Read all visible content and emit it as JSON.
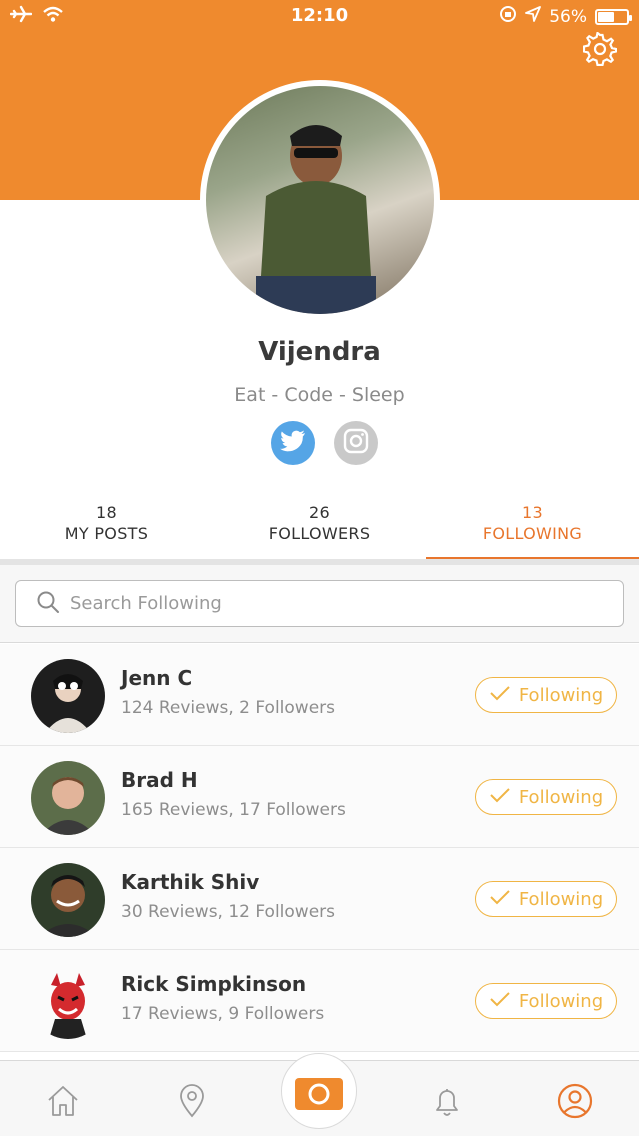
{
  "status_bar": {
    "time": "12:10",
    "battery": "56%"
  },
  "profile": {
    "name": "Vijendra",
    "bio": "Eat - Code - Sleep"
  },
  "stats": [
    {
      "count": "18",
      "label": "MY POSTS"
    },
    {
      "count": "26",
      "label": "FOLLOWERS"
    },
    {
      "count": "13",
      "label": "FOLLOWING"
    }
  ],
  "search": {
    "placeholder": "Search Following"
  },
  "following": [
    {
      "name": "Jenn C",
      "meta": "124 Reviews, 2 Followers",
      "button": "Following"
    },
    {
      "name": "Brad H",
      "meta": "165 Reviews, 17 Followers",
      "button": "Following"
    },
    {
      "name": "Karthik Shiv",
      "meta": "30 Reviews, 12 Followers",
      "button": "Following"
    },
    {
      "name": "Rick Simpkinson",
      "meta": "17 Reviews, 9 Followers",
      "button": "Following"
    }
  ],
  "colors": {
    "accent": "#ef8a2e",
    "follow": "#f0b545",
    "twitter": "#55a5e6"
  },
  "icons": [
    "airplane-icon",
    "wifi-icon",
    "orientation-lock-icon",
    "location-arrow-icon",
    "battery-icon",
    "gear-icon",
    "twitter-icon",
    "instagram-icon",
    "search-icon",
    "checkmark-icon",
    "home-icon",
    "map-pin-icon",
    "camera-icon",
    "bell-icon",
    "profile-icon"
  ]
}
